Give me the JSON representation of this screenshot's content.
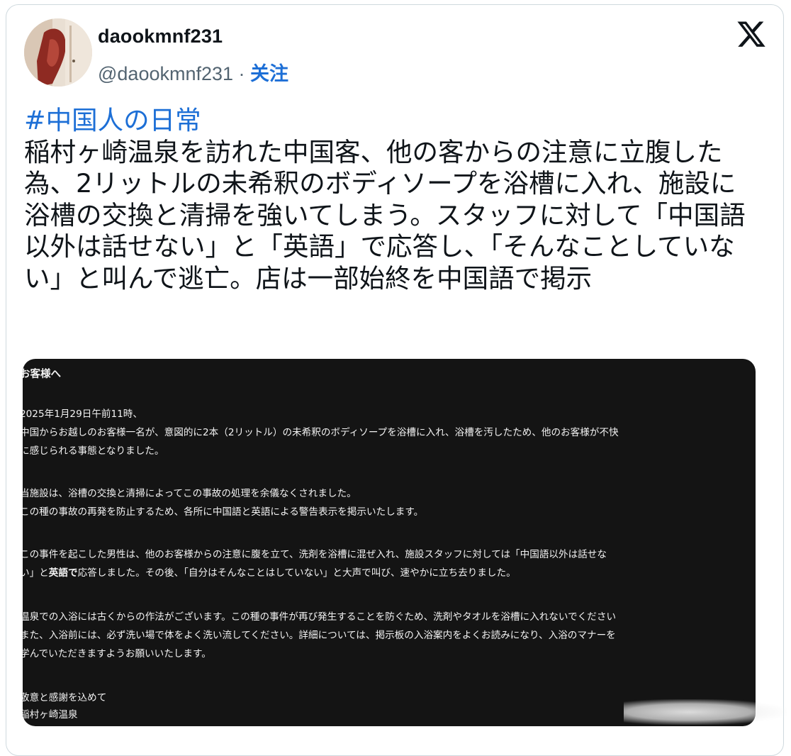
{
  "author": {
    "display_name": "daookmnf231",
    "handle": "@daookmnf231",
    "separator": " · ",
    "follow_label": "关注",
    "avatar_icon": "avatar-photo"
  },
  "brand": {
    "logo_icon": "x-logo-icon",
    "accent_color": "#1d6fd6"
  },
  "tweet": {
    "hashtag": "#中国人の日常",
    "body": "稲村ヶ崎温泉を訪れた中国客、他の客からの注意に立腹した為、2リットルの未希釈のボディソープを浴槽に入れ、施設に浴槽の交換と清掃を強いてしまう。スタッフに対して「中国語以外は話せない」と「英語」で応答し、「そんなことしていない」と叫んで逃亡。店は一部始終を中国語で掲示"
  },
  "notice": {
    "title": "お客様へ",
    "p1_line1": "2025年1月29日午前11時、",
    "p1_line2": "中国からお越しのお客様一名が、意図的に2本（2リットル）の未希釈のボディソープを浴槽に入れ、浴槽を汚したため、他のお客様が不快",
    "p1_line3": "に感じられる事態となりました。",
    "p2_line1": "当施設は、浴槽の交換と清掃によってこの事故の処理を余儀なくされました。",
    "p2_line2": "この種の事故の再発を防止するため、各所に中国語と英語による警告表示を掲示いたします。",
    "p3_line1": "この事件を起こした男性は、他のお客様からの注意に腹を立て、洗剤を浴槽に混ぜ入れ、施設スタッフに対しては「中国語以外は話せな",
    "p3_line2_a": "い」と",
    "p3_line2_b": "英語で",
    "p3_line2_c": "応答しました。その後、「自分はそんなことはしていない」と大声で叫び、速やかに立ち去りました。",
    "p4_line1": "温泉での入浴には古くからの作法がございます。この種の事件が再び発生することを防ぐため、洗剤やタオルを浴槽に入れないでください",
    "p4_line2": "また、入浴前には、必ず洗い場で体をよく洗い流してください。詳細については、掲示板の入浴案内をよくお読みになり、入浴のマナーを",
    "p4_line3": "学んでいただきますようお願いいたします。",
    "closing": "敬意と感謝を込めて",
    "signature": "稲村ヶ崎温泉"
  }
}
